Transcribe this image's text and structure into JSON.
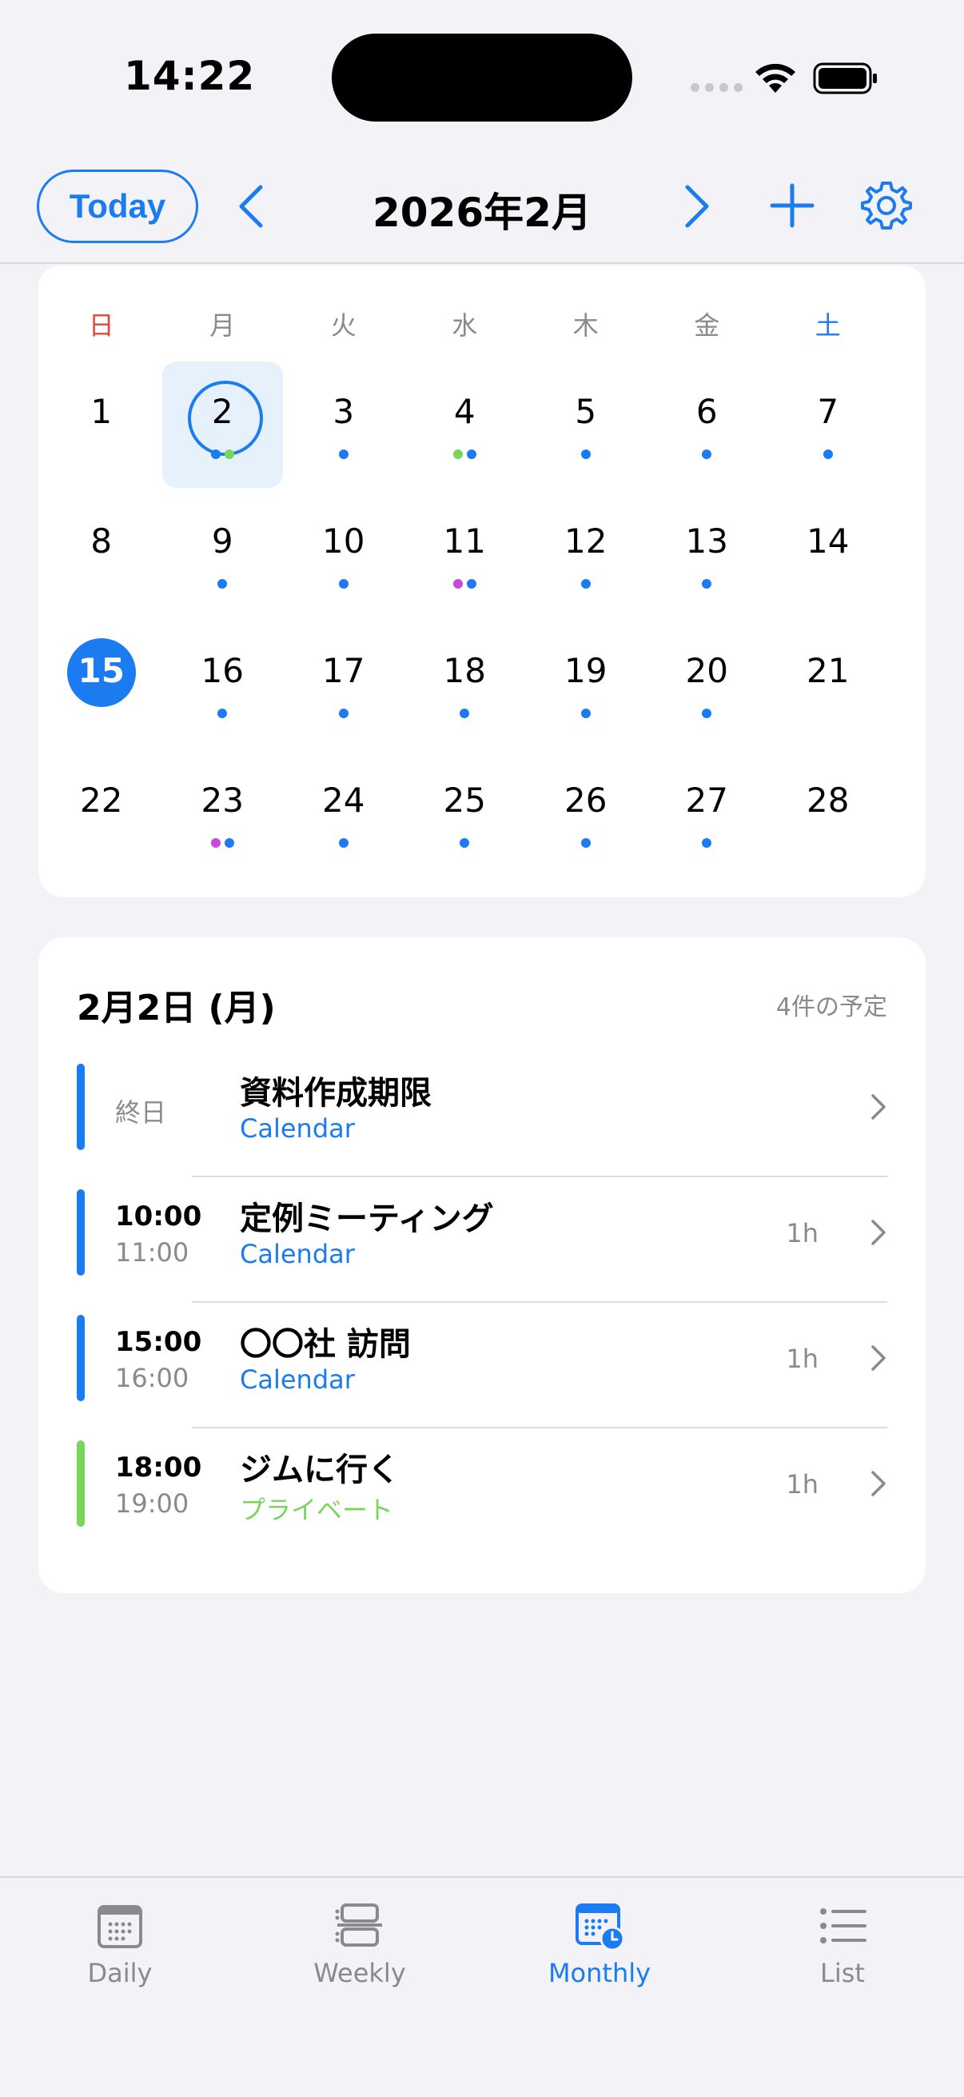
{
  "status_bar": {
    "time": "14:22"
  },
  "header": {
    "today_label": "Today",
    "month_title": "2026年2月"
  },
  "calendar": {
    "weekdays": [
      "日",
      "月",
      "火",
      "水",
      "木",
      "金",
      "土"
    ],
    "weeks": [
      [
        {
          "day": "1",
          "dots": []
        },
        {
          "day": "2",
          "dots": [
            "#1a7cf0",
            "#7ad65a"
          ],
          "selected": true
        },
        {
          "day": "3",
          "dots": [
            "#1a7cf0"
          ]
        },
        {
          "day": "4",
          "dots": [
            "#7ad65a",
            "#1a7cf0"
          ]
        },
        {
          "day": "5",
          "dots": [
            "#1a7cf0"
          ]
        },
        {
          "day": "6",
          "dots": [
            "#1a7cf0"
          ]
        },
        {
          "day": "7",
          "dots": [
            "#1a7cf0"
          ]
        }
      ],
      [
        {
          "day": "8",
          "dots": []
        },
        {
          "day": "9",
          "dots": [
            "#1a7cf0"
          ]
        },
        {
          "day": "10",
          "dots": [
            "#1a7cf0"
          ]
        },
        {
          "day": "11",
          "dots": [
            "#c84ad8",
            "#1a7cf0"
          ]
        },
        {
          "day": "12",
          "dots": [
            "#1a7cf0"
          ]
        },
        {
          "day": "13",
          "dots": [
            "#1a7cf0"
          ]
        },
        {
          "day": "14",
          "dots": []
        }
      ],
      [
        {
          "day": "15",
          "dots": [],
          "today": true
        },
        {
          "day": "16",
          "dots": [
            "#1a7cf0"
          ]
        },
        {
          "day": "17",
          "dots": [
            "#1a7cf0"
          ]
        },
        {
          "day": "18",
          "dots": [
            "#1a7cf0"
          ]
        },
        {
          "day": "19",
          "dots": [
            "#1a7cf0"
          ]
        },
        {
          "day": "20",
          "dots": [
            "#1a7cf0"
          ]
        },
        {
          "day": "21",
          "dots": []
        }
      ],
      [
        {
          "day": "22",
          "dots": []
        },
        {
          "day": "23",
          "dots": [
            "#c84ad8",
            "#1a7cf0"
          ]
        },
        {
          "day": "24",
          "dots": [
            "#1a7cf0"
          ]
        },
        {
          "day": "25",
          "dots": [
            "#1a7cf0"
          ]
        },
        {
          "day": "26",
          "dots": [
            "#1a7cf0"
          ]
        },
        {
          "day": "27",
          "dots": [
            "#1a7cf0"
          ]
        },
        {
          "day": "28",
          "dots": []
        }
      ]
    ]
  },
  "events": {
    "date_label": "2月2日 (月)",
    "count_label": "4件の予定",
    "items": [
      {
        "all_day_label": "終日",
        "title": "資料作成期限",
        "calendar": "Calendar",
        "color": "#1a7cf0",
        "duration": ""
      },
      {
        "start": "10:00",
        "end": "11:00",
        "title": "定例ミーティング",
        "calendar": "Calendar",
        "color": "#1a7cf0",
        "duration": "1h"
      },
      {
        "start": "15:00",
        "end": "16:00",
        "title": "〇〇社 訪問",
        "calendar": "Calendar",
        "color": "#1a7cf0",
        "duration": "1h"
      },
      {
        "start": "18:00",
        "end": "19:00",
        "title": "ジムに行く",
        "calendar": "プライベート",
        "color": "#7ad65a",
        "duration": "1h"
      }
    ]
  },
  "tabbar": {
    "tabs": [
      {
        "label": "Daily",
        "icon": "calendar-day-icon"
      },
      {
        "label": "Weekly",
        "icon": "calendar-week-icon"
      },
      {
        "label": "Monthly",
        "icon": "calendar-month-icon",
        "active": true
      },
      {
        "label": "List",
        "icon": "list-icon"
      }
    ]
  },
  "colors": {
    "accent": "#1a7cf0",
    "sunday": "#e8453c",
    "private": "#7ad65a",
    "purple": "#c84ad8"
  }
}
